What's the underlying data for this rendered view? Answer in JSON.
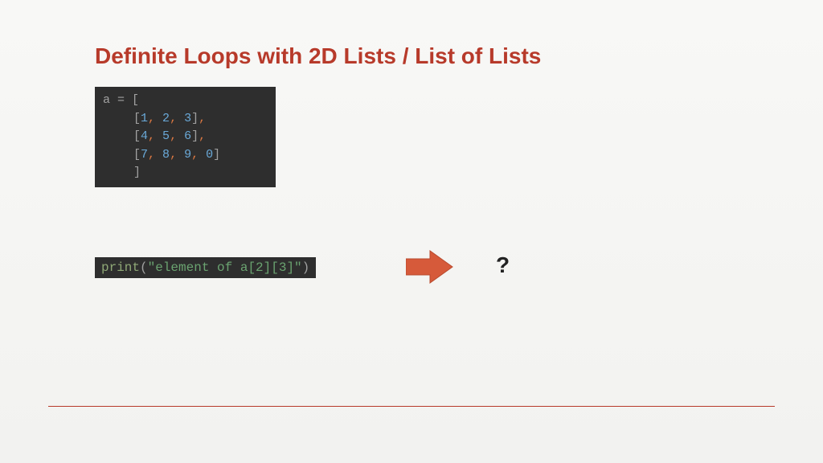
{
  "title": "Definite Loops with 2D Lists / List of Lists",
  "code1": {
    "line1_var": "a",
    "line1_op": " = ",
    "line1_br": "[",
    "line2_br1": "[",
    "line2_n1": "1",
    "line2_c1": ",",
    "line2_n2": " 2",
    "line2_c2": ",",
    "line2_n3": " 3",
    "line2_br2": "]",
    "line2_c3": ",",
    "line3_br1": "[",
    "line3_n1": "4",
    "line3_c1": ",",
    "line3_n2": " 5",
    "line3_c2": ",",
    "line3_n3": " 6",
    "line3_br2": "]",
    "line3_c3": ",",
    "line4_br1": "[",
    "line4_n1": "7",
    "line4_c1": ",",
    "line4_n2": " 8",
    "line4_c2": ",",
    "line4_n3": " 9",
    "line4_c3": ",",
    "line4_n4": " 0",
    "line4_br2": "]",
    "line5_br": "]"
  },
  "code2": {
    "fn": "print",
    "p1": "(",
    "str": "\"element of a[2][3]\"",
    "p2": ")"
  },
  "question": "?",
  "colors": {
    "title": "#b73a2a",
    "code_bg": "#2e2e2e",
    "arrow": "#d65a3a"
  }
}
